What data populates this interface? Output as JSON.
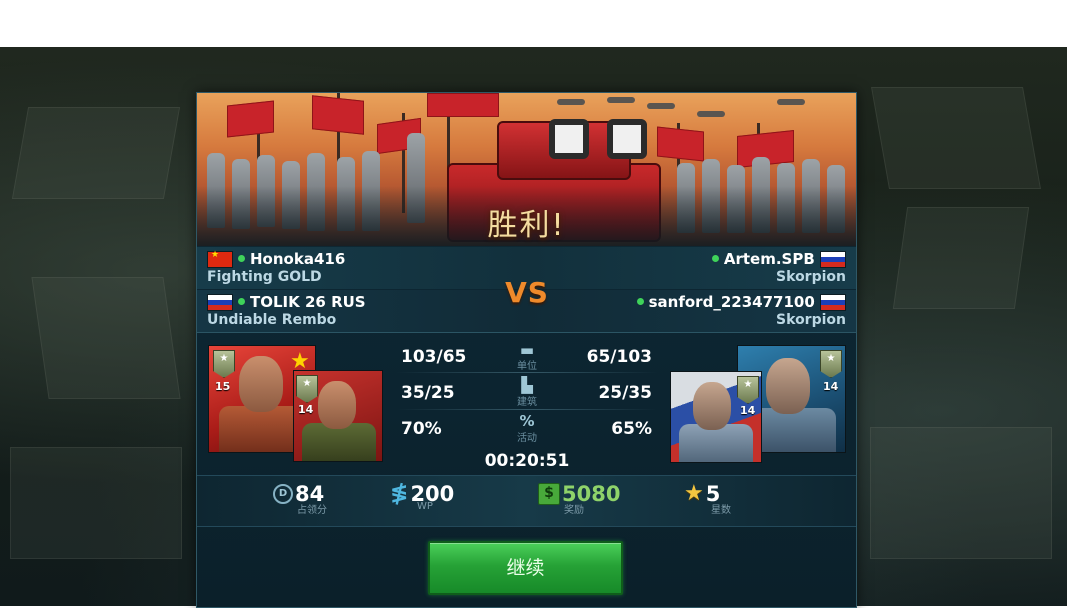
{
  "result": {
    "title": "胜利!"
  },
  "vs_label": "VS",
  "left_team": {
    "players": [
      {
        "name": "Honoka416",
        "subtitle": "Fighting GOLD",
        "flag": "china-flag-icon"
      },
      {
        "name": "TOLIK 26 RUS",
        "subtitle": "Undiable Rembo",
        "flag": "russia-flag-icon"
      }
    ],
    "portraits": [
      {
        "level": "15"
      },
      {
        "level": "14"
      }
    ]
  },
  "right_team": {
    "players": [
      {
        "name": "Artem.SPB",
        "subtitle": "Skorpion",
        "flag": "russia-flag-icon"
      },
      {
        "name": "sanford_223477100",
        "subtitle": "Skorpion",
        "flag": "russia-flag-icon"
      }
    ],
    "portraits": [
      {
        "level": "14"
      },
      {
        "level": "14"
      }
    ]
  },
  "stats": [
    {
      "icon": "tank-icon",
      "label": "单位",
      "left": "103/65",
      "right": "65/103"
    },
    {
      "icon": "factory-icon",
      "label": "建筑",
      "left": "35/25",
      "right": "25/35"
    },
    {
      "icon": "percent-icon",
      "label": "活动",
      "left": "70%",
      "right": "65%"
    }
  ],
  "timer": "00:20:51",
  "rewards": [
    {
      "icon": "domination-badge-icon",
      "value": "84",
      "label": "占领分"
    },
    {
      "icon": "wp-icon",
      "value": "200",
      "label": "WP"
    },
    {
      "icon": "cash-icon",
      "value": "5080",
      "label": "奖励"
    },
    {
      "icon": "star-icon",
      "value": "5",
      "label": "星数"
    }
  ],
  "continue_button": "继续",
  "colors": {
    "accent_orange": "#ef8a2b",
    "button_green": "#26a236",
    "online_dot": "#3fd35a",
    "panel_bg": "#0f2a35"
  }
}
